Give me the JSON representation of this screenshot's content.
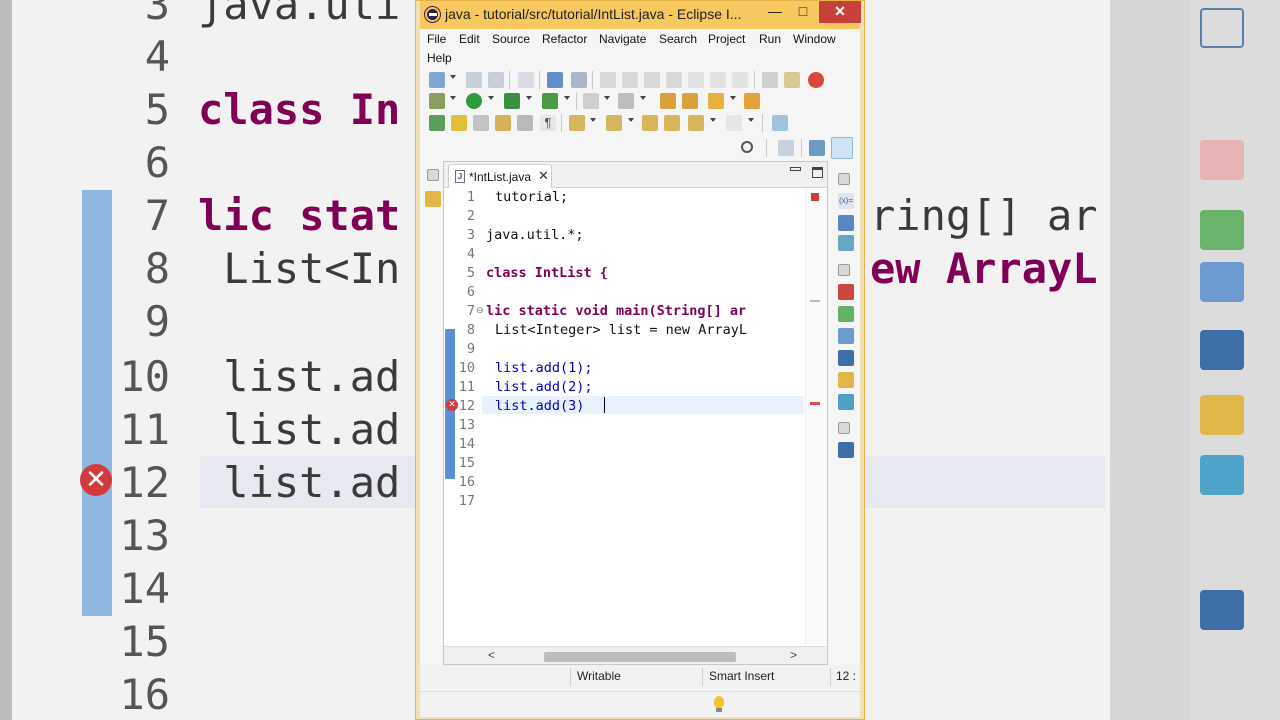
{
  "window": {
    "title": "java - tutorial/src/tutorial/IntList.java - Eclipse I...",
    "minimize_glyph": "—",
    "maximize_glyph": "□",
    "close_glyph": "✕"
  },
  "menu": {
    "items": [
      "File",
      "Edit",
      "Source",
      "Refactor",
      "Navigate",
      "Search",
      "Project",
      "Run",
      "Window",
      "Help"
    ]
  },
  "editor": {
    "tab_label": "*IntList.java",
    "tab_icon_letter": "J",
    "tab_close_glyph": "✕",
    "lines": [
      {
        "num": "1",
        "code": "tutorial;"
      },
      {
        "num": "2",
        "code": ""
      },
      {
        "num": "3",
        "code": "java.util.*;"
      },
      {
        "num": "4",
        "code": ""
      },
      {
        "num": "5",
        "code": "class IntList {"
      },
      {
        "num": "6",
        "code": ""
      },
      {
        "num": "7",
        "code": "lic static void main(String[] ar"
      },
      {
        "num": "8",
        "code": "List<Integer> list = new ArrayL"
      },
      {
        "num": "9",
        "code": ""
      },
      {
        "num": "10",
        "code": "list.add(1);"
      },
      {
        "num": "11",
        "code": "list.add(2);"
      },
      {
        "num": "12",
        "code": "list.add(3)"
      },
      {
        "num": "13",
        "code": ""
      },
      {
        "num": "14",
        "code": ""
      },
      {
        "num": "15",
        "code": ""
      },
      {
        "num": "16",
        "code": ""
      },
      {
        "num": "17",
        "code": ""
      }
    ],
    "error_glyph": "✕",
    "fold_glyph": "⊖"
  },
  "scrollbar": {
    "left_arrow": "<",
    "right_arrow": ">"
  },
  "status": {
    "writable": "Writable",
    "insert_mode": "Smart Insert",
    "position": "12 :"
  },
  "background": {
    "lines": [
      {
        "num": "3",
        "code": "java.uti"
      },
      {
        "num": "4",
        "code": ""
      },
      {
        "num": "5",
        "code": "class In"
      },
      {
        "num": "6",
        "code": ""
      },
      {
        "num": "7",
        "code": "lic stat"
      },
      {
        "num": "8",
        "code": " List<In"
      },
      {
        "num": "9",
        "code": ""
      },
      {
        "num": "10",
        "code": " list.ad"
      },
      {
        "num": "11",
        "code": " list.ad"
      },
      {
        "num": "12",
        "code": " list.ad"
      },
      {
        "num": "13",
        "code": ""
      },
      {
        "num": "14",
        "code": ""
      },
      {
        "num": "15",
        "code": ""
      },
      {
        "num": "16",
        "code": ""
      }
    ],
    "right_fragment_1": "ring[] ar",
    "right_fragment_2": "ew ArrayL"
  },
  "colors": {
    "title_bar": "#f7c760",
    "keyword": "#7f0055",
    "field": "#0000c0",
    "error": "#d23b3b",
    "change_bar": "#5b8fd6"
  }
}
